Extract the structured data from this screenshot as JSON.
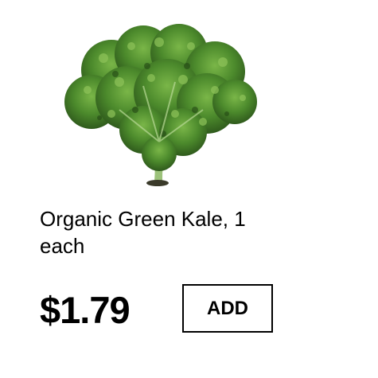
{
  "product": {
    "name": "Organic Green Kale, 1 each",
    "price": "$1.79",
    "image_icon": "kale-image",
    "colors": {
      "leaf_dark": "#2f5a1c",
      "leaf_mid": "#4c8a2c",
      "leaf_light": "#7ab648",
      "stem": "#9cc27a"
    }
  },
  "actions": {
    "add_label": "ADD"
  }
}
